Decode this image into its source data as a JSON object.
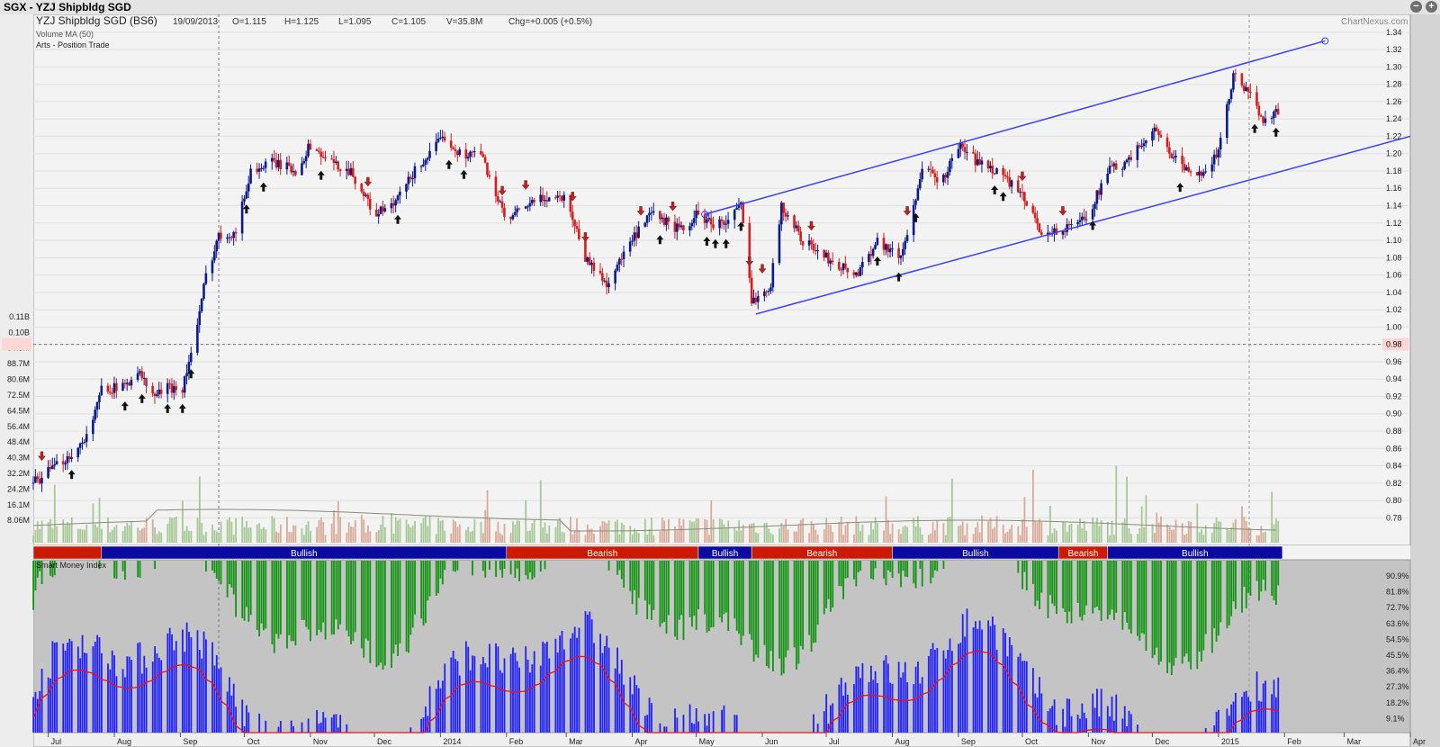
{
  "window": {
    "title": "SGX - YZJ Shipbldg SGD",
    "minimize_icon": "minus-icon",
    "add_icon": "plus-icon"
  },
  "header": {
    "name": "YZJ Shipbldg SGD (BS6)",
    "date": "19/09/2013",
    "open": "O=1.115",
    "high": "H=1.125",
    "low": "L=1.095",
    "close": "C=1.105",
    "volume": "V=35.8M",
    "change": "Chg=+0.005 (+0.5%)",
    "source": "ChartNexus.com"
  },
  "overlays": {
    "volume_label": "Volume MA (50)",
    "strategy_label": "Arts - Position Trade",
    "smi_label": "Smart Money Index"
  },
  "colors": {
    "bull": "#0b1a8a",
    "bear": "#d21e1e",
    "band_bull": "#0a0aa0",
    "band_bear": "#cc1a00",
    "trendline": "#3b3bff",
    "smi_bar": "#1f1fff",
    "smi_green": "#119411",
    "smi_red": "#ee1111",
    "smi_purple": "#b01cb0",
    "vol_bull": "#a6c896",
    "vol_bear": "#d8aa98"
  },
  "x_axis": [
    "Jul",
    "Aug",
    "Sep",
    "Oct",
    "Nov",
    "Dec",
    "2014",
    "Feb",
    "Mar",
    "Apr",
    "May",
    "Jun",
    "Jul",
    "Aug",
    "Sep",
    "Oct",
    "Nov",
    "Dec",
    "2015",
    "Feb",
    "Mar",
    "Apr"
  ],
  "price_ticks": [
    "1.34",
    "1.32",
    "1.30",
    "1.28",
    "1.26",
    "1.24",
    "1.22",
    "1.20",
    "1.18",
    "1.16",
    "1.14",
    "1.12",
    "1.10",
    "1.08",
    "1.06",
    "1.04",
    "1.02",
    "1.00",
    "0.98",
    "0.96",
    "0.94",
    "0.92",
    "0.90",
    "0.88",
    "0.86",
    "0.84",
    "0.82",
    "0.80",
    "0.78"
  ],
  "current_price_label": "0.98",
  "volume_ticks": [
    "0.11B",
    "0.10B",
    "94.3M",
    "88.7M",
    "80.6M",
    "72.5M",
    "64.5M",
    "56.4M",
    "48.4M",
    "40.3M",
    "32.2M",
    "24.2M",
    "16.1M",
    "8.06M"
  ],
  "smi_ticks": [
    "90.9%",
    "81.8%",
    "72.7%",
    "63.6%",
    "54.5%",
    "45.5%",
    "36.4%",
    "27.3%",
    "18.2%",
    "9.1%"
  ],
  "chart_data": {
    "type": "candlestick",
    "title": "YZJ Shipbldg SGD (BS6)",
    "ylim": [
      0.77,
      1.345
    ],
    "x_range": [
      "2013-06-24",
      "2015-04-01"
    ],
    "series_points": [
      [
        "2013-06-24",
        0.82
      ],
      [
        "2013-07-05",
        0.84
      ],
      [
        "2013-07-15",
        0.86
      ],
      [
        "2013-07-22",
        0.89
      ],
      [
        "2013-07-26",
        0.93
      ],
      [
        "2013-08-05",
        0.93
      ],
      [
        "2013-08-12",
        0.95
      ],
      [
        "2013-08-19",
        0.92
      ],
      [
        "2013-08-26",
        0.93
      ],
      [
        "2013-09-02",
        0.93
      ],
      [
        "2013-09-09",
        1.0
      ],
      [
        "2013-09-13",
        1.06
      ],
      [
        "2013-09-19",
        1.105
      ],
      [
        "2013-09-27",
        1.11
      ],
      [
        "2013-10-04",
        1.18
      ],
      [
        "2013-10-15",
        1.19
      ],
      [
        "2013-10-25",
        1.18
      ],
      [
        "2013-11-01",
        1.21
      ],
      [
        "2013-11-10",
        1.19
      ],
      [
        "2013-11-20",
        1.18
      ],
      [
        "2013-12-01",
        1.13
      ],
      [
        "2013-12-10",
        1.14
      ],
      [
        "2013-12-20",
        1.18
      ],
      [
        "2014-01-03",
        1.22
      ],
      [
        "2014-01-10",
        1.2
      ],
      [
        "2014-01-20",
        1.2
      ],
      [
        "2014-02-01",
        1.12
      ],
      [
        "2014-02-10",
        1.14
      ],
      [
        "2014-02-20",
        1.15
      ],
      [
        "2014-03-01",
        1.15
      ],
      [
        "2014-03-10",
        1.08
      ],
      [
        "2014-03-20",
        1.05
      ],
      [
        "2014-04-01",
        1.1
      ],
      [
        "2014-04-10",
        1.13
      ],
      [
        "2014-04-25",
        1.11
      ],
      [
        "2014-05-01",
        1.13
      ],
      [
        "2014-05-08",
        1.12
      ],
      [
        "2014-05-15",
        1.12
      ],
      [
        "2014-05-22",
        1.14
      ],
      [
        "2014-05-27",
        1.03
      ],
      [
        "2014-06-05",
        1.05
      ],
      [
        "2014-06-10",
        1.14
      ],
      [
        "2014-06-20",
        1.1
      ],
      [
        "2014-07-01",
        1.08
      ],
      [
        "2014-07-15",
        1.06
      ],
      [
        "2014-07-25",
        1.1
      ],
      [
        "2014-08-05",
        1.08
      ],
      [
        "2014-08-15",
        1.18
      ],
      [
        "2014-08-25",
        1.17
      ],
      [
        "2014-09-01",
        1.21
      ],
      [
        "2014-09-10",
        1.19
      ],
      [
        "2014-09-20",
        1.18
      ],
      [
        "2014-10-01",
        1.15
      ],
      [
        "2014-10-10",
        1.11
      ],
      [
        "2014-10-20",
        1.11
      ],
      [
        "2014-11-01",
        1.13
      ],
      [
        "2014-11-10",
        1.18
      ],
      [
        "2014-11-20",
        1.19
      ],
      [
        "2014-12-01",
        1.23
      ],
      [
        "2014-12-10",
        1.2
      ],
      [
        "2014-12-20",
        1.17
      ],
      [
        "2015-01-01",
        1.2
      ],
      [
        "2015-01-08",
        1.29
      ],
      [
        "2015-01-15",
        1.27
      ],
      [
        "2015-01-22",
        1.24
      ],
      [
        "2015-01-29",
        1.25
      ]
    ],
    "trend_bands": [
      {
        "label": "",
        "type": "bear",
        "from": "2013-06-24",
        "to": "2013-07-26"
      },
      {
        "label": "Bullish",
        "type": "bull",
        "from": "2013-07-26",
        "to": "2014-02-01"
      },
      {
        "label": "Bearish",
        "type": "bear",
        "from": "2014-02-01",
        "to": "2014-05-02"
      },
      {
        "label": "Bullish",
        "type": "bull",
        "from": "2014-05-02",
        "to": "2014-05-27"
      },
      {
        "label": "Bearish",
        "type": "bear",
        "from": "2014-05-27",
        "to": "2014-08-01"
      },
      {
        "label": "Bullish",
        "type": "bull",
        "from": "2014-08-01",
        "to": "2014-10-18"
      },
      {
        "label": "Bearish",
        "type": "bear",
        "from": "2014-10-18",
        "to": "2014-11-10"
      },
      {
        "label": "Bullish",
        "type": "bull",
        "from": "2014-11-10",
        "to": "2015-01-31"
      }
    ],
    "trendlines": [
      {
        "from": [
          "2014-05-05",
          1.13
        ],
        "to": [
          "2015-02-20",
          1.33
        ]
      },
      {
        "from": [
          "2014-05-29",
          1.015
        ],
        "to": [
          "2015-04-01",
          1.22
        ]
      }
    ],
    "up_arrows": [
      "2013-07-12",
      "2013-08-06",
      "2013-08-14",
      "2013-08-26",
      "2013-09-02",
      "2013-09-06",
      "2013-10-02",
      "2013-10-10",
      "2013-11-06",
      "2013-12-12",
      "2014-01-05",
      "2014-01-12",
      "2014-04-14",
      "2014-05-06",
      "2014-05-10",
      "2014-05-15",
      "2014-05-22",
      "2014-07-25",
      "2014-08-04",
      "2014-08-12",
      "2014-09-18",
      "2014-09-22",
      "2014-11-03",
      "2014-12-14",
      "2015-01-18",
      "2015-01-28"
    ],
    "down_arrows": [
      "2013-06-28",
      "2013-11-28",
      "2014-01-30",
      "2014-02-10",
      "2014-03-04",
      "2014-03-10",
      "2014-04-05",
      "2014-04-20",
      "2014-05-26",
      "2014-06-01",
      "2014-06-24",
      "2014-08-08",
      "2014-10-01",
      "2014-10-20"
    ]
  }
}
